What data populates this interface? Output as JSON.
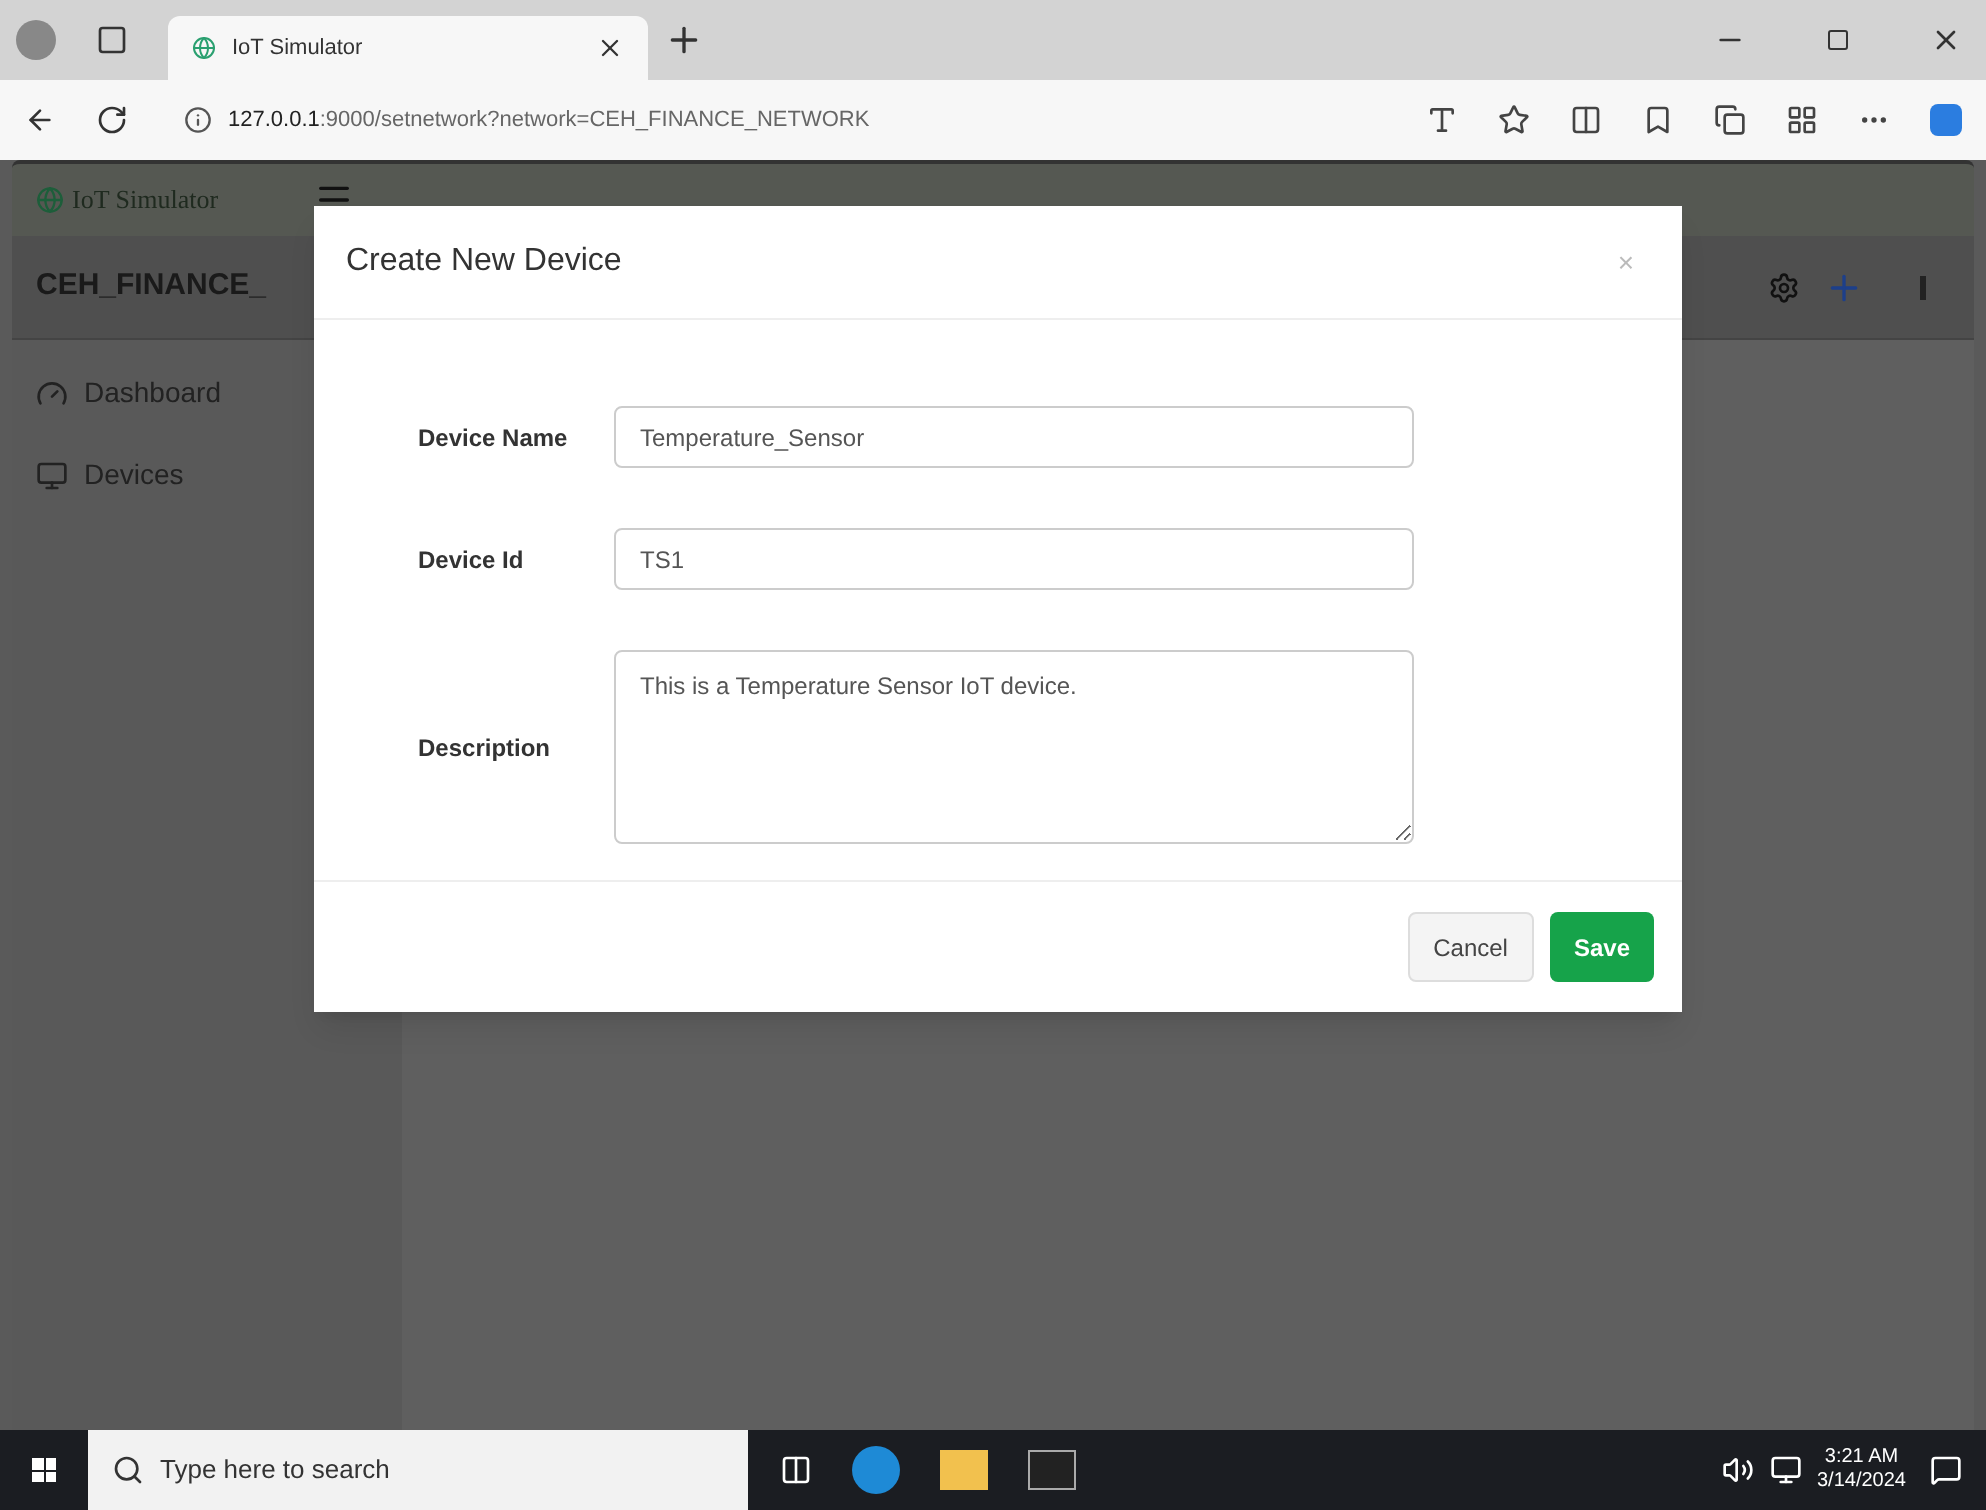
{
  "browser": {
    "tab_title": "IoT Simulator",
    "url_host": "127.0.0.1",
    "url_rest": ":9000/setnetwork?network=CEH_FINANCE_NETWORK"
  },
  "app": {
    "brand": "IoT Simulator",
    "network_title": "CEH_FINANCE_"
  },
  "sidebar": {
    "items": [
      {
        "kind": "dashboard",
        "label": "Dashboard"
      },
      {
        "kind": "devices",
        "label": "Devices"
      }
    ]
  },
  "modal": {
    "title": "Create New Device",
    "close": "×",
    "fields": [
      {
        "kind": "text",
        "label": "Device Name",
        "value": "Temperature_Sensor"
      },
      {
        "kind": "text",
        "label": "Device Id",
        "value": "TS1"
      },
      {
        "kind": "textarea",
        "label": "Description",
        "value": "This is a Temperature Sensor IoT device."
      }
    ],
    "buttons": [
      {
        "kind": "secondary",
        "label": "Cancel"
      },
      {
        "kind": "primary",
        "label": "Save"
      }
    ]
  },
  "taskbar": {
    "search_placeholder": "Type here to search",
    "time": "3:21 AM",
    "date": "3/14/2024"
  }
}
